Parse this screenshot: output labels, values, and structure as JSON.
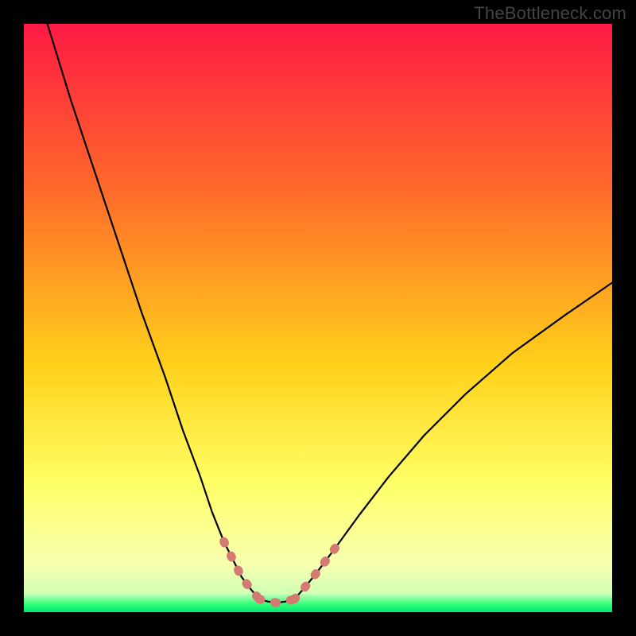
{
  "watermark": {
    "text": "TheBottleneck.com"
  },
  "colors": {
    "black": "#000000",
    "curve": "#000000",
    "highlight": "#d57a72",
    "grad_top": "#ff1a44",
    "grad_mid1": "#ff6a2a",
    "grad_mid2": "#ffd11a",
    "grad_low1": "#ffff66",
    "grad_low2": "#f7ffb0",
    "green_top": "#b6ffb6",
    "green_mid": "#33ff77",
    "green_bot": "#00e676"
  },
  "chart_data": {
    "type": "line",
    "title": "",
    "xlabel": "",
    "ylabel": "",
    "xlim": [
      0,
      100
    ],
    "ylim": [
      0,
      100
    ],
    "green_zone_threshold": 3,
    "series": [
      {
        "name": "curve-left",
        "x": [
          4,
          8,
          12,
          16,
          20,
          24,
          27,
          30,
          32,
          34,
          35.5,
          37,
          38.5,
          40
        ],
        "y": [
          100,
          87,
          75,
          63,
          51,
          40,
          31,
          23,
          17,
          12,
          9,
          6,
          4,
          2.2
        ]
      },
      {
        "name": "curve-right",
        "x": [
          46,
          48,
          50,
          53,
          57,
          62,
          68,
          75,
          83,
          92,
          100
        ],
        "y": [
          2.2,
          4.5,
          7,
          11,
          16.5,
          23,
          30,
          37,
          44,
          50.5,
          56
        ]
      },
      {
        "name": "valley-floor",
        "x": [
          40,
          41.5,
          43,
          44.5,
          46
        ],
        "y": [
          2.2,
          1.8,
          1.6,
          1.8,
          2.2
        ]
      }
    ],
    "highlight_segments": [
      {
        "belongs_to": "curve-left",
        "x": [
          34,
          35.5,
          37,
          38.5,
          40
        ],
        "y": [
          12,
          9,
          6,
          4,
          2.2
        ]
      },
      {
        "belongs_to": "valley-floor",
        "x": [
          40,
          41.5,
          43,
          44.5,
          46
        ],
        "y": [
          2.2,
          1.8,
          1.6,
          1.8,
          2.2
        ]
      },
      {
        "belongs_to": "curve-right",
        "x": [
          46,
          48,
          50,
          53
        ],
        "y": [
          2.2,
          4.5,
          7,
          11
        ]
      }
    ]
  }
}
